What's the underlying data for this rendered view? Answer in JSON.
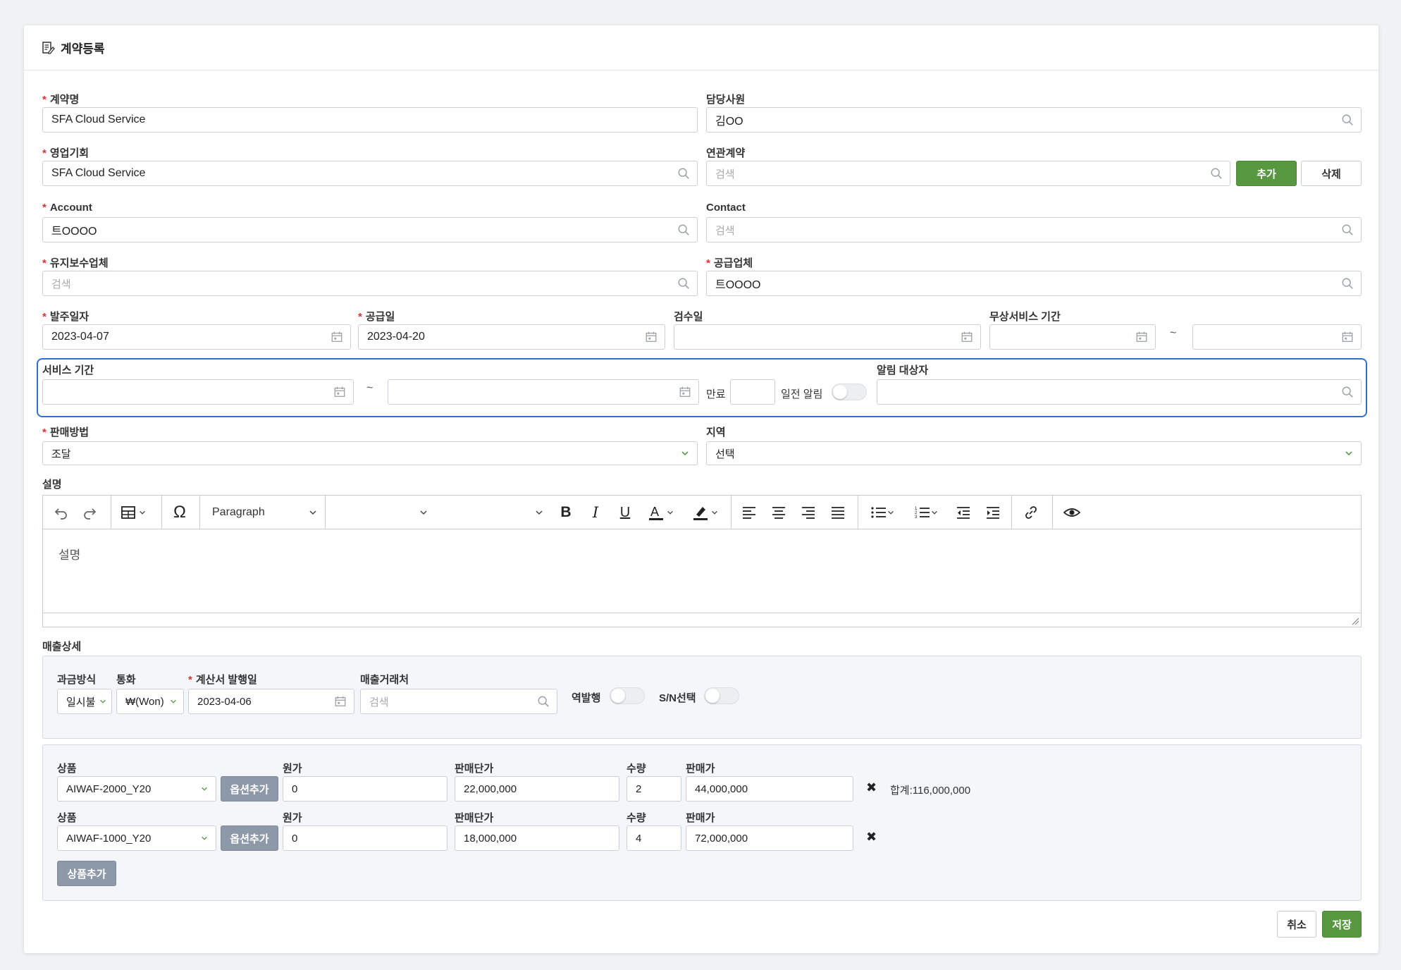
{
  "header": {
    "title": "계약등록",
    "icon": "document-edit-icon"
  },
  "fields": {
    "contract_name": {
      "label": "계약명",
      "value": "SFA Cloud Service"
    },
    "employee": {
      "label": "담당사원",
      "value": "김OO"
    },
    "opportunity": {
      "label": "영업기회",
      "value": "SFA Cloud Service"
    },
    "related_contract": {
      "label": "연관계약",
      "placeholder": "검색",
      "add_label": "추가",
      "delete_label": "삭제"
    },
    "account": {
      "label": "Account",
      "value": "트OOOO"
    },
    "contact": {
      "label": "Contact",
      "placeholder": "검색"
    },
    "maintenance": {
      "label": "유지보수업체",
      "placeholder": "검색"
    },
    "supplier": {
      "label": "공급업체",
      "value": "트OOOO"
    },
    "order_date": {
      "label": "발주일자",
      "value": "2023-04-07"
    },
    "supply_date": {
      "label": "공급일",
      "value": "2023-04-20"
    },
    "inspection_date": {
      "label": "검수일",
      "value": ""
    },
    "free_service": {
      "label": "무상서비스 기간",
      "tilde": "~"
    },
    "service_period": {
      "label": "서비스 기간",
      "tilde": "~",
      "expire_label": "만료",
      "notice_label": "일전 알림"
    },
    "alert_target": {
      "label": "알림 대상자"
    },
    "sales_method": {
      "label": "판매방법",
      "value": "조달"
    },
    "region": {
      "label": "지역",
      "value": "선택"
    },
    "description": {
      "label": "설명",
      "placeholder": "설명",
      "paragraph": "Paragraph"
    }
  },
  "sales": {
    "label": "매출상세",
    "billing_label": "과금방식",
    "billing_value": "일시불",
    "currency_label": "통화",
    "currency_value": "₩(Won)",
    "invoice_label": "계산서 발행일",
    "invoice_value": "2023-04-06",
    "client_label": "매출거래처",
    "client_placeholder": "검색",
    "reverse_label": "역발행",
    "sn_label": "S/N선택"
  },
  "products": {
    "product_label": "상품",
    "cost_label": "원가",
    "unit_price_label": "판매단가",
    "qty_label": "수량",
    "sale_price_label": "판매가",
    "option_add_label": "옵션추가",
    "product_add_label": "상품추가",
    "total_text": "합계:116,000,000",
    "remove_symbol": "✖",
    "rows": [
      {
        "product": "AIWAF-2000_Y20",
        "cost": "0",
        "unit_price": "22,000,000",
        "qty": "2",
        "sale_price": "44,000,000"
      },
      {
        "product": "AIWAF-1000_Y20",
        "cost": "0",
        "unit_price": "18,000,000",
        "qty": "4",
        "sale_price": "72,000,000"
      }
    ]
  },
  "footer": {
    "cancel_label": "취소",
    "save_label": "저장"
  },
  "colors": {
    "accent_green": "#56973f",
    "highlight_blue": "#2f6fd0",
    "required_red": "#d9342b"
  }
}
